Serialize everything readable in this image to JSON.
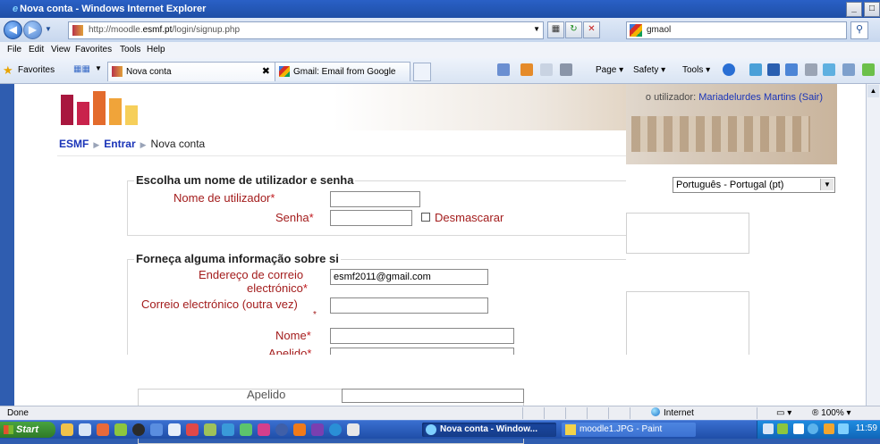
{
  "window": {
    "title": "Nova conta - Windows Internet Explorer",
    "min": "_",
    "max": "□"
  },
  "address": {
    "url_prefix": "http://moodle.",
    "url_host": "esmf.pt",
    "url_path": "/login/signup.php",
    "search_value": "gmaol"
  },
  "menu": [
    "File",
    "Edit",
    "View",
    "Favorites",
    "Tools",
    "Help"
  ],
  "favorites_bar": {
    "favorites_label": "Favorites",
    "tabs": [
      {
        "label": "Nova conta",
        "close": "✖"
      },
      {
        "label": "Gmail: Email from Google"
      }
    ],
    "commands": [
      "Page ▾",
      "Safety ▾",
      "Tools ▾"
    ]
  },
  "page": {
    "user_info_prefix": "o utilizador:",
    "user_name": "Mariadelurdes Martins",
    "logout": "(Sair)",
    "language_select": "Português - Portugal (pt)",
    "breadcrumb": [
      "ESMF",
      "Entrar",
      "Nova conta"
    ],
    "section1": {
      "legend": "Escolha um nome de utilizador e senha",
      "username_label": "Nome de utilizador",
      "password_label": "Senha",
      "unmask_label": "Desmascarar"
    },
    "section2": {
      "legend": "Forneça alguma informação sobre si",
      "email_label_1": "Endereço de correio",
      "email_label_2": "electrónico",
      "email_value": "esmf2011@gmail.com",
      "email2_label": "Correio electrónico (outra vez)",
      "firstname_label": "Nome",
      "lastname_label": "Apelido"
    },
    "required_mark": "*",
    "lower_lastname_label": "Apelido"
  },
  "statusbar": {
    "status": "Done",
    "zone": "Internet",
    "zoom": "® 100%  ▾"
  },
  "taskbar": {
    "start": "Start",
    "tasks": [
      "Nova conta - Window...",
      "moodle1.JPG - Paint"
    ],
    "clock": "11:59"
  }
}
